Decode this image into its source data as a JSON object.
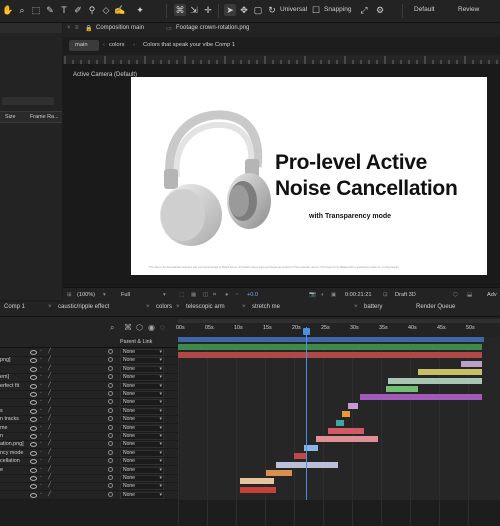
{
  "toolbar": {
    "universal_label": "Universal",
    "snapping_label": "Snapping",
    "workspace_default": "Default",
    "workspace_review": "Review"
  },
  "project_panel": {
    "col_size": "Size",
    "col_frame_rate": "Frame Ra..."
  },
  "comp_tabs": {
    "composition_tab": "Composition main",
    "footage_tab": "Footage crown-rotation.png"
  },
  "breadcrumbs": {
    "main": "main",
    "colors": "colors",
    "comp": "Colors that speak your vibe Comp 1"
  },
  "viewer": {
    "camera_label": "Active Camera (Default)",
    "headline_line1": "Pro-level Active",
    "headline_line2": "Noise Cancellation",
    "subline": "with Transparency mode",
    "fineprint": "This video is for demonstration purposes only. Conceptual design by Sketch Source. All product names, logos and brands are property of their respective owners. This project is not affiliated with or endorsed by Apple Inc. or those brands."
  },
  "comp_footer": {
    "zoom": "(100%)",
    "resolution": "Full",
    "exposure": "+0.0",
    "timecode": "0:00:21:21",
    "renderer": "Draft 3D",
    "adv": "Adv"
  },
  "timeline_tabs": [
    "Comp 1",
    "caustic/ripple effect",
    "colors",
    "telescopic arm",
    "stretch me",
    "battery",
    "Render Queue"
  ],
  "timeline": {
    "parent_header": "Parent & Link",
    "ticks": [
      "00s",
      "05s",
      "10s",
      "15s",
      "20s",
      "25s",
      "30s",
      "35s",
      "40s",
      "45s",
      "50s"
    ],
    "playhead_time_label": "21:21"
  },
  "layers": [
    {
      "name": "",
      "parent": "None"
    },
    {
      "name": "png]",
      "parent": "None"
    },
    {
      "name": "",
      "parent": "None"
    },
    {
      "name": "em]",
      "parent": "None"
    },
    {
      "name": "erfect fit",
      "parent": "None"
    },
    {
      "name": "",
      "parent": "None"
    },
    {
      "name": "",
      "parent": "None"
    },
    {
      "name": "s",
      "parent": "None"
    },
    {
      "name": "n tracks",
      "parent": "None"
    },
    {
      "name": "me",
      "parent": "None"
    },
    {
      "name": "n",
      "parent": "None"
    },
    {
      "name": "ation.png]",
      "parent": "None"
    },
    {
      "name": "ncy mode",
      "parent": "None"
    },
    {
      "name": "cellation",
      "parent": "None"
    },
    {
      "name": "e",
      "parent": "None"
    },
    {
      "name": "",
      "parent": "None"
    },
    {
      "name": "",
      "parent": "None"
    },
    {
      "name": "",
      "parent": "None"
    }
  ],
  "colors": {
    "accent": "#4a8fe0",
    "playhead": "#4a8fe0",
    "canvas_bg": "#ffffff",
    "headline_text": "#111111"
  }
}
